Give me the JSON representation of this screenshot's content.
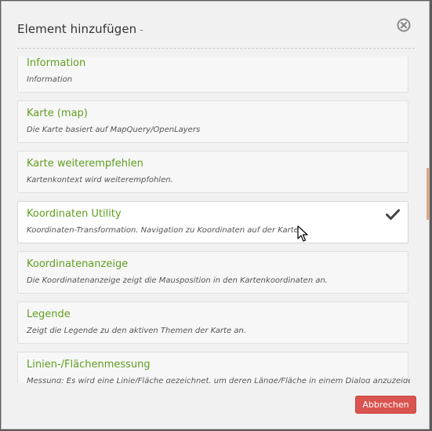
{
  "dialog": {
    "title": "Element hinzufügen",
    "title_suffix": "-",
    "cancel_label": "Abbrechen"
  },
  "items": [
    {
      "title": "Information",
      "description": "Information",
      "selected": false
    },
    {
      "title": "Karte (map)",
      "description": "Die Karte basiert auf MapQuery/OpenLayers",
      "selected": false
    },
    {
      "title": "Karte weiterempfehlen",
      "description": "Kartenkontext wird weiterempfohlen.",
      "selected": false
    },
    {
      "title": "Koordinaten Utility",
      "description": "Koordinaten-Transformation. Navigation zu Koordinaten auf der Karte.",
      "selected": true
    },
    {
      "title": "Koordinatenanzeige",
      "description": "Die Koordinatenanzeige zeigt die Mausposition in den Kartenkoordinaten an.",
      "selected": false
    },
    {
      "title": "Legende",
      "description": "Zeigt die Legende zu den aktiven Themen der Karte an.",
      "selected": false
    },
    {
      "title": "Linien-/Flächenmessung",
      "description": "Messung: Es wird eine Linie/Fläche gezeichnet, um deren Länge/Fläche in einem Dialog anzuzeigen.",
      "selected": false
    }
  ],
  "colors": {
    "item_title": "#5f9e1f",
    "cancel_button": "#d9534f"
  },
  "icons": {
    "close": "close-circle-icon",
    "selected": "check-icon",
    "pointer": "mouse-cursor-icon"
  }
}
